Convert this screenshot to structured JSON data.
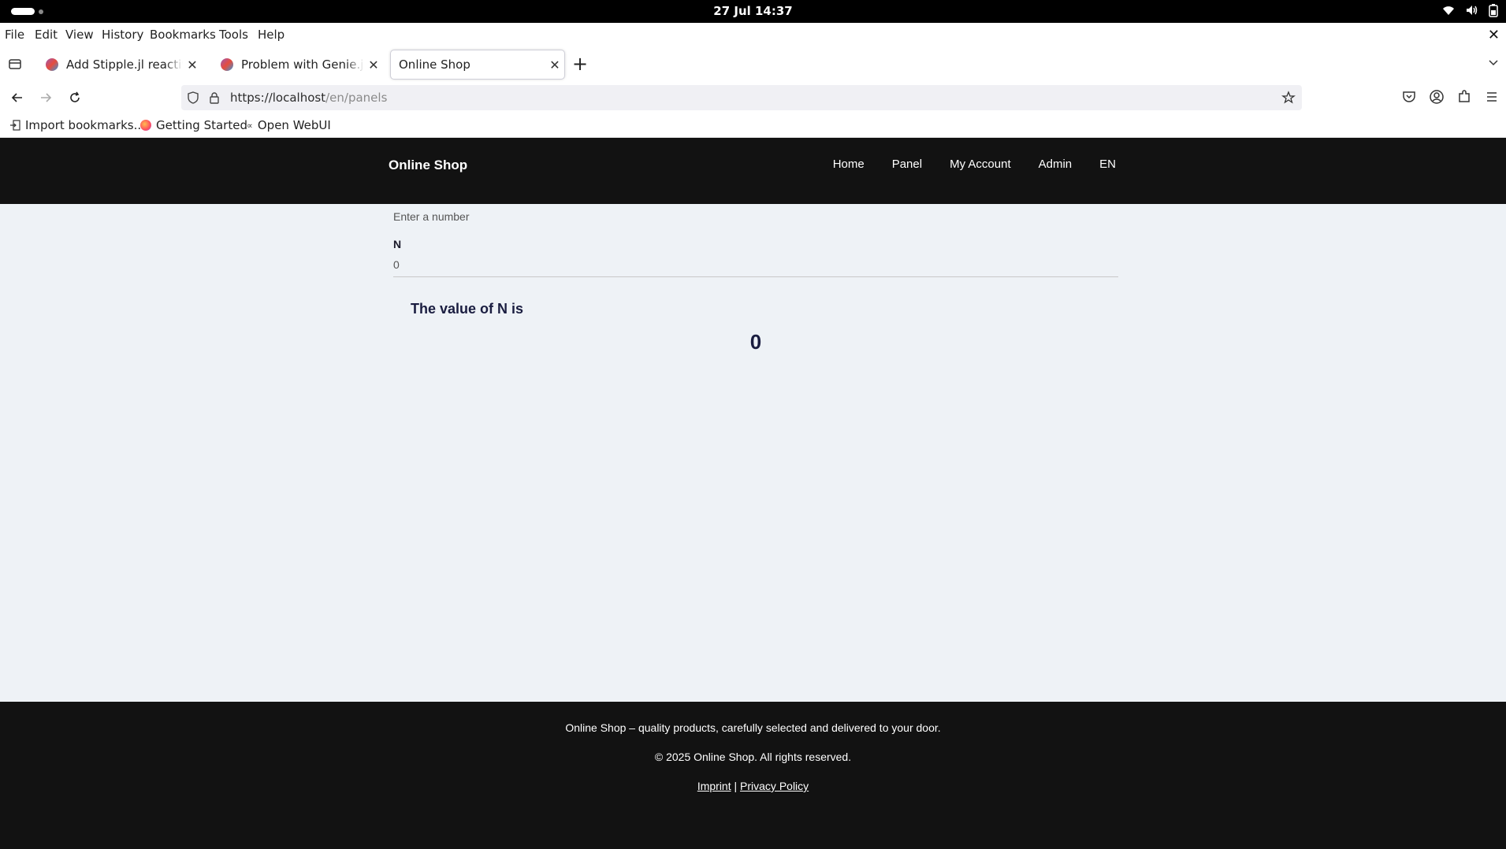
{
  "system": {
    "clock": "27 Jul  14:37"
  },
  "menubar": {
    "items": [
      "File",
      "Edit",
      "View",
      "History",
      "Bookmarks",
      "Tools",
      "Help"
    ]
  },
  "tabs": [
    {
      "label": "Add Stipple.jl reactive ele",
      "active": false
    },
    {
      "label": "Problem with Genie.jl nev",
      "active": false
    },
    {
      "label": "Online Shop",
      "active": true
    }
  ],
  "navbar": {
    "url_host": "https://localhost",
    "url_path": "/en/panels"
  },
  "bookmarks": [
    {
      "label": "Import bookmarks...",
      "icon": "import-icon"
    },
    {
      "label": "Getting Started",
      "icon": "firefox-icon"
    },
    {
      "label": "Open WebUI",
      "icon": "webui-icon"
    }
  ],
  "site": {
    "brand": "Online Shop",
    "nav": [
      "Home",
      "Panel",
      "My Account",
      "Admin",
      "EN"
    ]
  },
  "main": {
    "hint": "Enter a number",
    "field_label": "N",
    "field_value": "0",
    "value_heading": "The value of N is",
    "value_number": "0"
  },
  "footer": {
    "tagline": "Online Shop – quality products, carefully selected and delivered to your door.",
    "copyright": "© 2025 Online Shop. All rights reserved.",
    "imprint": "Imprint",
    "separator": "|",
    "privacy": "Privacy Policy"
  }
}
